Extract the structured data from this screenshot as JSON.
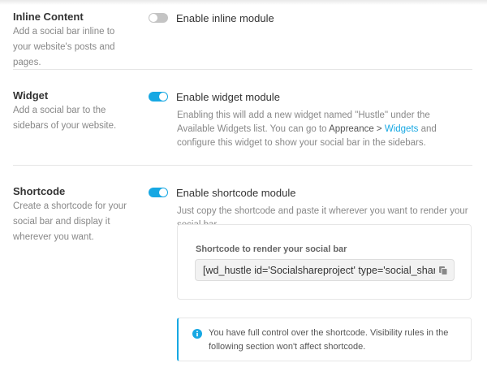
{
  "sections": {
    "inline": {
      "title": "Inline Content",
      "description": "Add a social bar inline to your website's posts and pages.",
      "toggle_label": "Enable inline module",
      "enabled": false
    },
    "widget": {
      "title": "Widget",
      "description": "Add a social bar to the sidebars of your website.",
      "toggle_label": "Enable widget module",
      "enabled": true,
      "help_prefix": "Enabling this will add a new widget named \"Hustle\" under the Available Widgets list. You can go to ",
      "help_appearance": "Appreance",
      "help_sep": " > ",
      "help_widgets": "Widgets",
      "help_suffix": " and configure this widget to show your social bar in the sidebars."
    },
    "shortcode": {
      "title": "Shortcode",
      "description": "Create a shortcode for your social bar and display it wherever you want.",
      "toggle_label": "Enable shortcode module",
      "enabled": true,
      "help": "Just copy the shortcode and paste it wherever you want to render your social bar.",
      "field_label": "Shortcode to render your social bar",
      "field_value": "[wd_hustle id='Socialshareproject' type='social_shari",
      "notice": "You have full control over the shortcode. Visibility rules in the following section won't affect shortcode."
    }
  },
  "icons": {
    "copy": "copy-icon",
    "info": "info-icon"
  },
  "colors": {
    "accent": "#17a8e3",
    "toggle_off": "#c4c4c4"
  }
}
